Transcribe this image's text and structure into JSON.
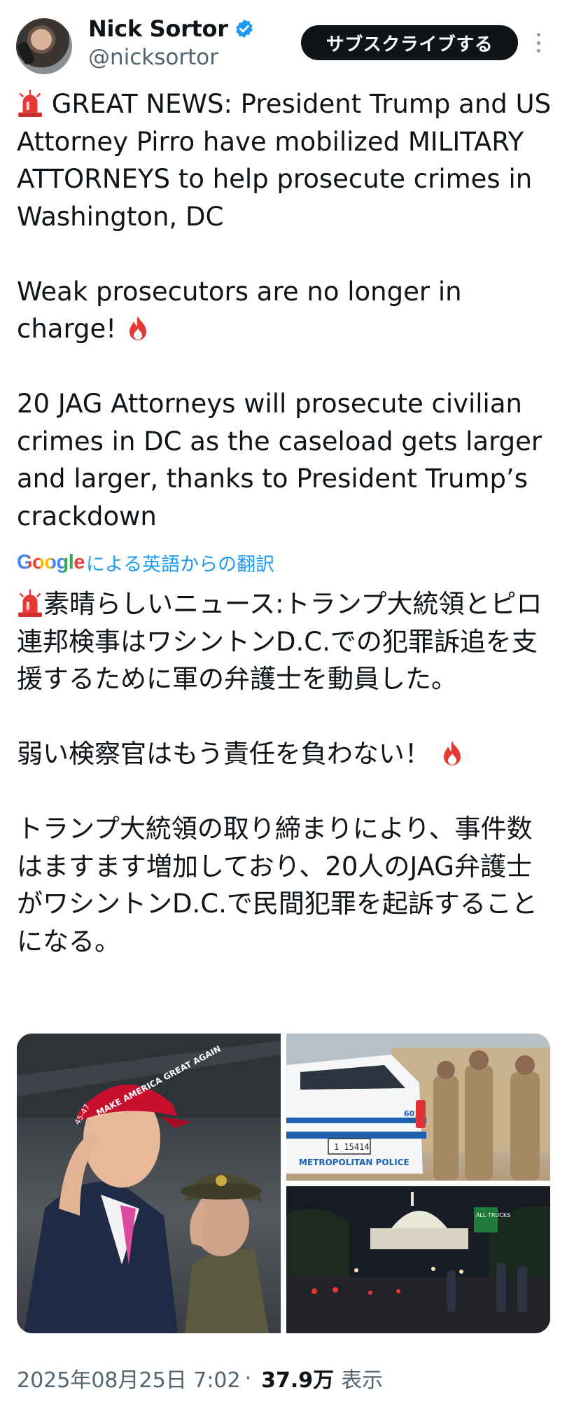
{
  "header": {
    "display_name": "Nick Sortor",
    "handle": "@nicksortor",
    "subscribe_label": "サブスクライブする",
    "verified_color": "#1d9bf0"
  },
  "tweet": {
    "en_p1": "GREAT NEWS: President Trump and US Attorney Pirro have mobilized MILITARY ATTORNEYS to help prosecute crimes in Washington, DC",
    "en_p2": "Weak prosecutors are no longer in charge!",
    "en_p3": "20 JAG Attorneys will prosecute civilian crimes in DC as the caseload gets larger and larger, thanks to President Trump’s crackdown",
    "translation_provider": "Google",
    "translation_label": "による英語からの翻訳",
    "jp_p1": "素晴らしいニュース:トランプ大統領とピロ連邦検事はワシントンD.C.での犯罪訴追を支援するために軍の弁護士を動員した。",
    "jp_p2": "弱い検察官はもう責任を負わない！",
    "jp_p3": "トランプ大統領の取り締まりにより、事件数はますます増加しており、20人のJAG弁護士がワシントンD.C.で民間犯罪を起訴することになる。"
  },
  "media": {
    "hat_text": "MAKE AMERICA GREAT AGAIN",
    "hat_side": "45-47",
    "car_text": "METROPOLITAN POLICE",
    "car_plate": "1 15414",
    "car_unit": "601",
    "sign_text": "ALL TRUCKS"
  },
  "footer": {
    "timestamp": "2025年08月25日 7:02",
    "separator": "·",
    "views": "37.9万",
    "views_label": "表示"
  },
  "icons": [
    "siren-icon",
    "fire-icon",
    "verified-icon",
    "more-icon"
  ]
}
